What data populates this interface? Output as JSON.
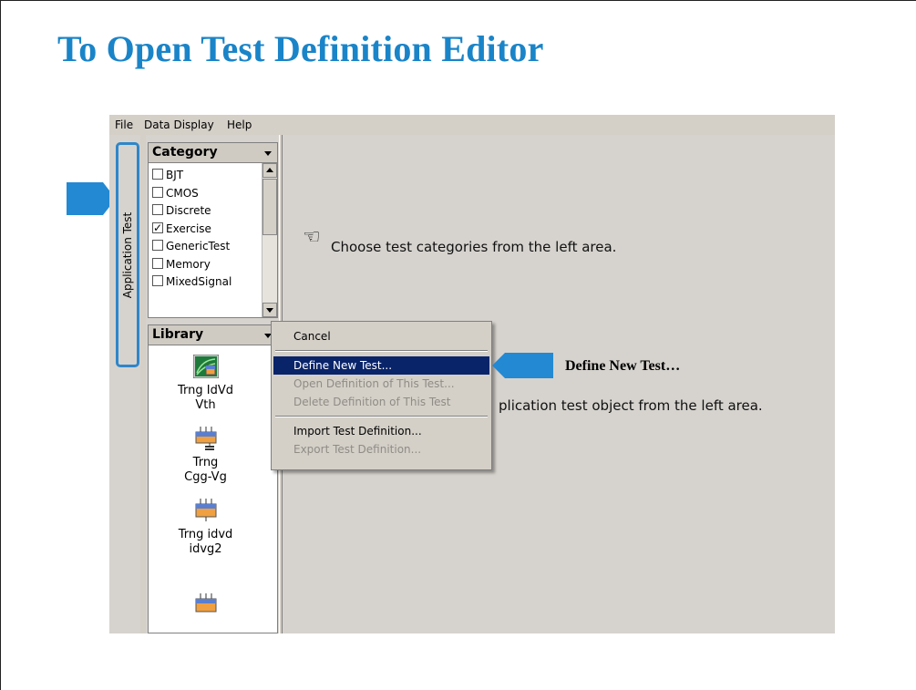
{
  "slide": {
    "title": "To Open Test Definition Editor",
    "callout": "Define New Test…"
  },
  "menubar": {
    "items": [
      "File",
      "Data Display",
      "Help"
    ]
  },
  "vertical_tab": {
    "label": "Application Test"
  },
  "category_panel": {
    "header": "Category",
    "items": [
      {
        "label": "BJT",
        "checked": false
      },
      {
        "label": "CMOS",
        "checked": false
      },
      {
        "label": "Discrete",
        "checked": false
      },
      {
        "label": "Exercise",
        "checked": true
      },
      {
        "label": "GenericTest",
        "checked": false
      },
      {
        "label": "Memory",
        "checked": false
      },
      {
        "label": "MixedSignal",
        "checked": false
      }
    ]
  },
  "library_panel": {
    "header": "Library",
    "items": [
      {
        "line1": "Trng IdVd",
        "line2": "Vth",
        "icon": "idvd-graph-icon"
      },
      {
        "line1": "Trng",
        "line2": "Cgg-Vg",
        "icon": "capacitor-device-icon"
      },
      {
        "line1": "Trng idvd",
        "line2": "idvg2",
        "icon": "transistor-device-icon"
      }
    ]
  },
  "main_area": {
    "hint1": "Choose test categories from the left area.",
    "hint2": "plication test object from the left area."
  },
  "context_menu": {
    "items": [
      {
        "label": "Cancel",
        "disabled": false,
        "selected": false
      },
      {
        "label": "Define New Test...",
        "disabled": false,
        "selected": true
      },
      {
        "label": "Open Definition of This Test...",
        "disabled": true,
        "selected": false
      },
      {
        "label": "Delete Definition of This Test",
        "disabled": true,
        "selected": false
      },
      {
        "label": "Import Test Definition...",
        "disabled": false,
        "selected": false
      },
      {
        "label": "Export Test Definition...",
        "disabled": true,
        "selected": false
      }
    ]
  },
  "colors": {
    "title": "#1a84c8",
    "arrow": "#2389d3",
    "selection": "#0a246a"
  }
}
